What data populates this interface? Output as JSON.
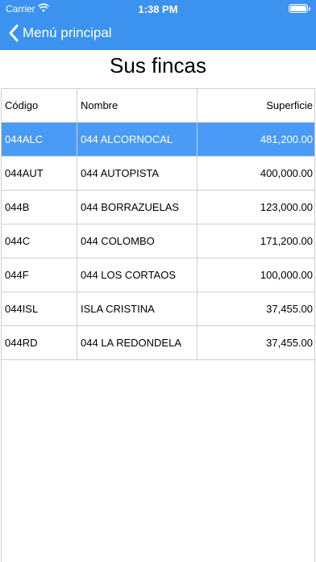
{
  "status": {
    "carrier": "Carrier",
    "time": "1:38 PM"
  },
  "nav": {
    "back_label": "Menú principal"
  },
  "page": {
    "title": "Sus fincas"
  },
  "table": {
    "headers": [
      "Código",
      "Nombre",
      "Superficie"
    ],
    "rows": [
      [
        "044ALC",
        "044 ALCORNOCAL",
        "481,200.00"
      ],
      [
        "044AUT",
        "044 AUTOPISTA",
        "400,000.00"
      ],
      [
        "044B",
        "044 BORRAZUELAS",
        "123,000.00"
      ],
      [
        "044C",
        "044 COLOMBO",
        "171,200.00"
      ],
      [
        "044F",
        "044 LOS CORTAOS",
        "100,000.00"
      ],
      [
        "044ISL",
        "ISLA CRISTINA",
        "37,455.00"
      ],
      [
        "044RD",
        "044 LA REDONDELA",
        "37,455.00"
      ]
    ],
    "selected_row": 0
  },
  "colors": {
    "accent": "#3b93ef",
    "selected_row": "#4a9bf5",
    "grid": "#cfcfcf"
  }
}
